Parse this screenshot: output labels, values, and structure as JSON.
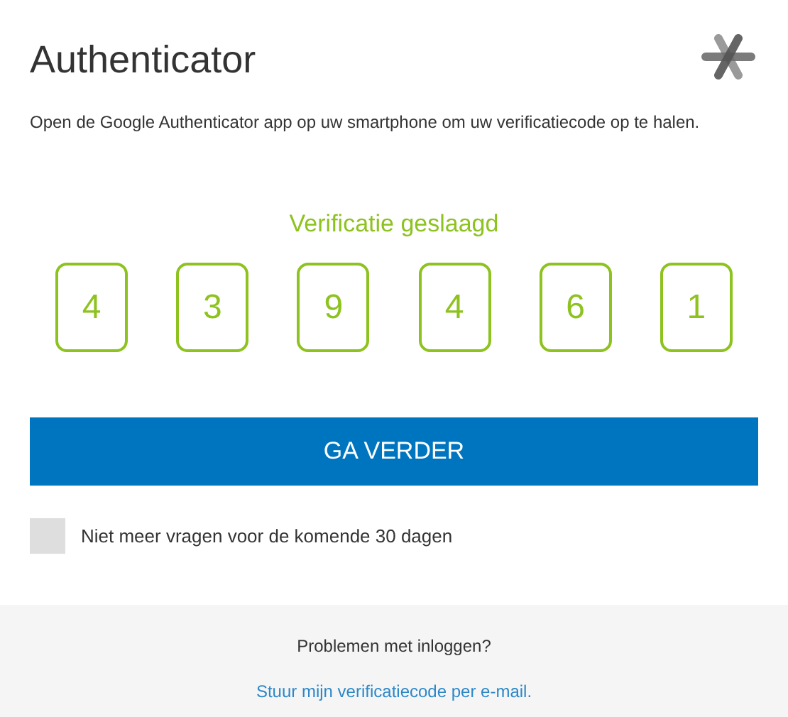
{
  "title": "Authenticator",
  "description": "Open de Google Authenticator app op uw smartphone om uw verificatiecode op te halen.",
  "status": {
    "message": "Verificatie geslaagd",
    "success": true
  },
  "code_digits": [
    "4",
    "3",
    "9",
    "4",
    "6",
    "1"
  ],
  "continue_button": "GA VERDER",
  "remember": {
    "label": "Niet meer vragen voor de komende 30 dagen",
    "checked": false
  },
  "footer": {
    "question": "Problemen met inloggen?",
    "link": "Stuur mijn verificatiecode per e-mail."
  }
}
